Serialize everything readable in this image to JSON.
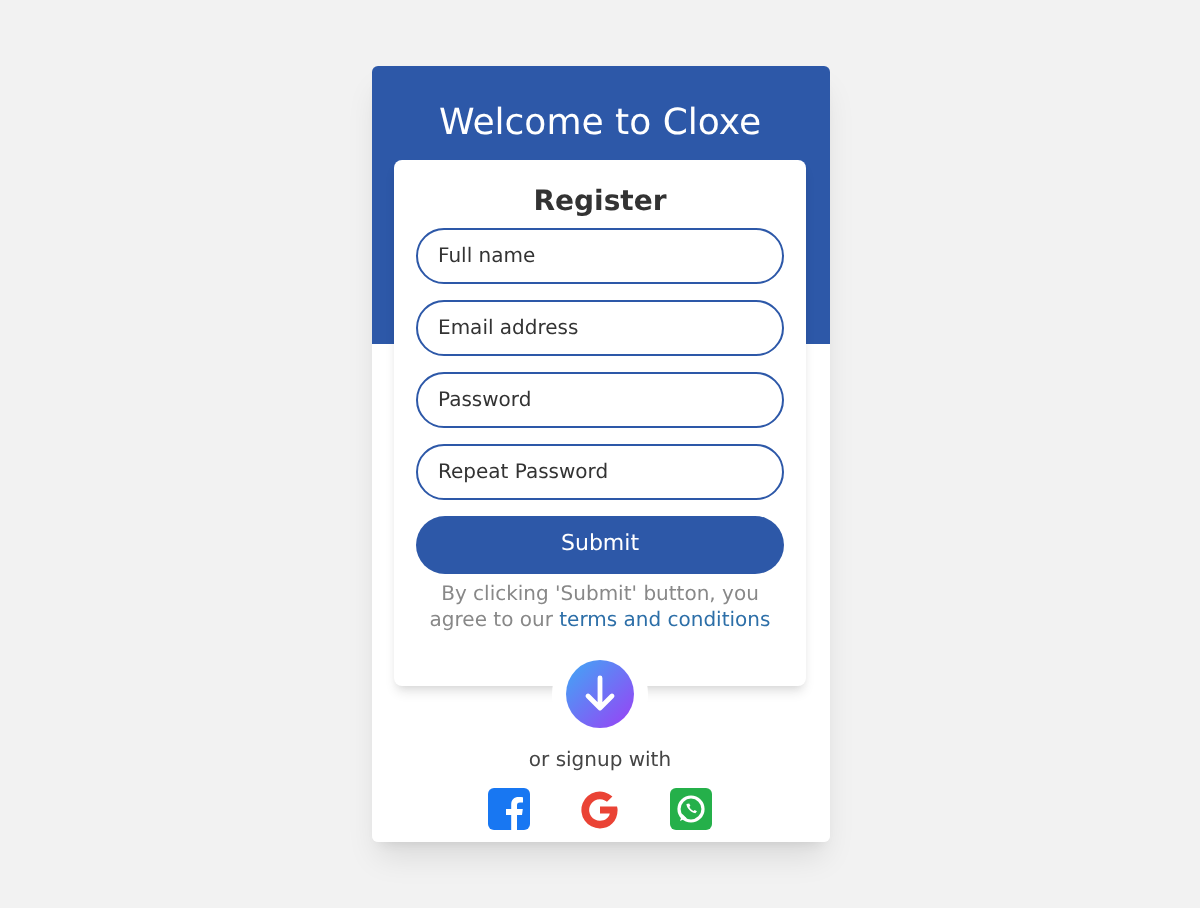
{
  "header": {
    "title": "Welcome to Cloxe"
  },
  "form": {
    "title": "Register",
    "fields": [
      {
        "placeholder": "Full name"
      },
      {
        "placeholder": "Email address"
      },
      {
        "placeholder": "Password"
      },
      {
        "placeholder": "Repeat Password"
      }
    ],
    "submit": "Submit",
    "notice": "By clicking 'Submit' button, you agree to our",
    "link": "terms and conditions"
  },
  "social": {
    "caption": "or signup with",
    "buttons": [
      {
        "kind": "facebook"
      },
      {
        "kind": "google"
      },
      {
        "kind": "whatsapp"
      }
    ]
  }
}
